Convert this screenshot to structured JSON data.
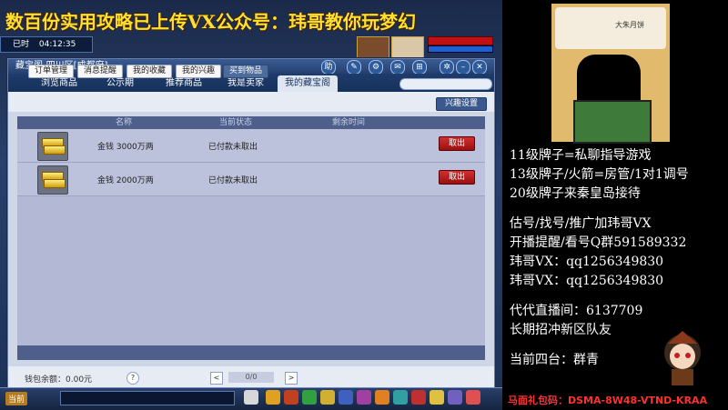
{
  "banner": "数百份实用攻略已上传VX公众号：玮哥教你玩梦幻",
  "hud": {
    "label": "已时",
    "time": "04:12:35"
  },
  "window": {
    "title": "藏宝阁-四川区[成都府]",
    "title_icons": [
      "help-icon",
      "pin-icon",
      "settings-icon",
      "chat-icon",
      "cart-icon",
      "gear-icon",
      "minimize-icon",
      "close-icon"
    ],
    "title_help": "助",
    "tabs": [
      "浏览商品",
      "公示期",
      "推荐商品",
      "我是卖家",
      "我的藏宝阁"
    ],
    "active_tab": "我的藏宝阁",
    "subtabs": [
      "订单管理",
      "消息提醒",
      "我的收藏",
      "我的兴趣",
      "买到物品"
    ],
    "active_subtab": "买到物品",
    "settings_button": "兴趣设置",
    "columns": [
      "名称",
      "当前状态",
      "剩余时间"
    ],
    "rows": [
      {
        "name": "金钱 3000万两",
        "status": "已付款未取出",
        "action": "取出"
      },
      {
        "name": "金钱 2000万两",
        "status": "已付款未取出",
        "action": "取出"
      }
    ],
    "footer": {
      "balance_label": "钱包余额：0.00元",
      "help": "?",
      "page": "0/0",
      "prev": "<",
      "next": ">"
    }
  },
  "taskbar": {
    "label": "当前"
  },
  "overlay": {
    "lines": [
      "11级牌子=私聊指导游戏",
      "13级牌子/火箭=房管/1对1调号",
      "20级牌子来秦皇岛接待",
      "",
      "估号/找号/推广加玮哥VX",
      "开播提醒/看号Q群591589332",
      "玮哥VX：qq1256349830",
      "玮哥VX：qq1256349830",
      "",
      "代代直播间：6137709",
      "长期招冲新区队友",
      "",
      "当前四台：群青"
    ],
    "bottom_note": "马面礼包码：DSMA-8W48-VTND-KRAA",
    "art_text": "大朱月饼"
  },
  "colors": {
    "banner": "#ffe030",
    "accent": "#25406e",
    "take_button": "#c02020",
    "note": "#ff3030"
  }
}
